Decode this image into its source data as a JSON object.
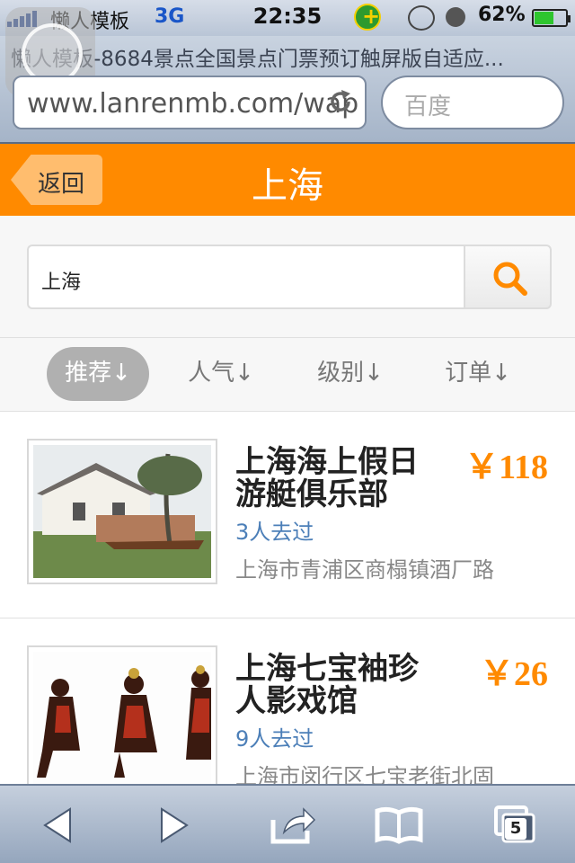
{
  "status_bar": {
    "carrier": "懒人模板",
    "network": "3G",
    "time": "22:35",
    "battery_percent": "62%",
    "battery_level": 0.62
  },
  "browser": {
    "page_title": "懒人模板-8684景点全国景点门票预订触屏版自适应...",
    "url": "www.lanrenmb.com/wap",
    "search_placeholder": "百度"
  },
  "header": {
    "back_label": "返回",
    "title": "上海",
    "accent_color": "#ff8a00"
  },
  "search": {
    "value": "上海"
  },
  "sort_tabs": [
    {
      "label": "推荐↓",
      "active": true
    },
    {
      "label": "人气↓",
      "active": false
    },
    {
      "label": "级别↓",
      "active": false
    },
    {
      "label": "订单↓",
      "active": false
    }
  ],
  "items": [
    {
      "name": "上海海上假日游艇俱乐部",
      "price": "￥118",
      "visited": "3人去过",
      "address": "上海市青浦区商榻镇酒厂路"
    },
    {
      "name": "上海七宝袖珍人影戏馆",
      "price": "￥26",
      "visited": "9人去过",
      "address": "上海市闵行区七宝老街北固"
    }
  ],
  "toolbar": {
    "tabs_count": "5"
  }
}
